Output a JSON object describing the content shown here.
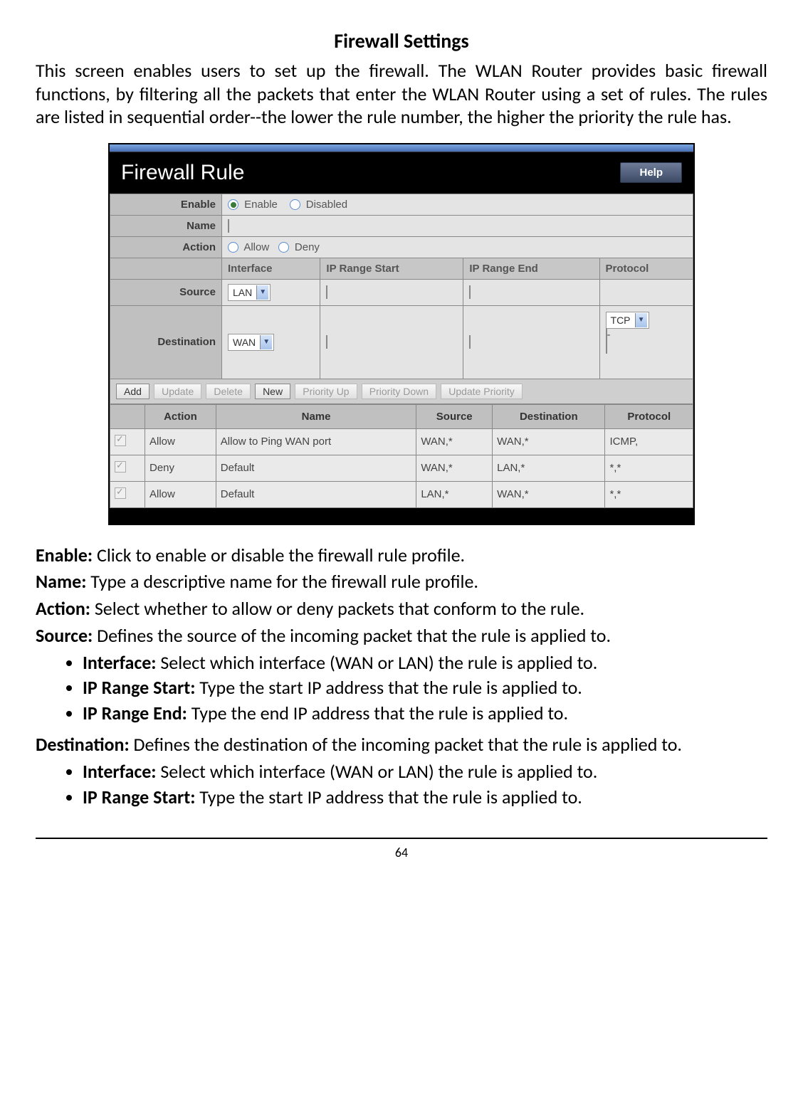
{
  "page": {
    "title": "Firewall Settings",
    "intro": "This screen enables users to set up the firewall. The WLAN Router provides basic firewall functions, by filtering all the packets that enter the WLAN Router using a set of rules. The rules are listed in sequential order--the lower the rule number, the higher the priority the rule has.",
    "page_number": "64"
  },
  "screenshot": {
    "panel_title": "Firewall Rule",
    "help_label": "Help",
    "labels": {
      "enable": "Enable",
      "name": "Name",
      "action": "Action",
      "source": "Source",
      "destination": "Destination"
    },
    "enable_options": {
      "enable": "Enable",
      "disabled": "Disabled"
    },
    "action_options": {
      "allow": "Allow",
      "deny": "Deny"
    },
    "columns": {
      "interface": "Interface",
      "ip_start": "IP Range Start",
      "ip_end": "IP Range End",
      "protocol": "Protocol"
    },
    "selects": {
      "source_if": "LAN",
      "dest_if": "WAN",
      "dest_proto": "TCP"
    },
    "buttons": {
      "add": "Add",
      "update": "Update",
      "delete": "Delete",
      "new": "New",
      "pri_up": "Priority Up",
      "pri_down": "Priority Down",
      "upd_pri": "Update Priority"
    },
    "rule_headers": {
      "action": "Action",
      "name": "Name",
      "source": "Source",
      "destination": "Destination",
      "protocol": "Protocol"
    },
    "rules": [
      {
        "action": "Allow",
        "name": "Allow to Ping WAN port",
        "source": "WAN,*",
        "dest": "WAN,*",
        "proto": "ICMP,"
      },
      {
        "action": "Deny",
        "name": "Default",
        "source": "WAN,*",
        "dest": "LAN,*",
        "proto": "*,*"
      },
      {
        "action": "Allow",
        "name": "Default",
        "source": "LAN,*",
        "dest": "WAN,*",
        "proto": "*,*"
      }
    ]
  },
  "defs": {
    "enable": {
      "term": "Enable:",
      "text": " Click to enable or disable the firewall rule profile."
    },
    "name": {
      "term": "Name:",
      "text": " Type a descriptive name for the firewall rule profile."
    },
    "action": {
      "term": "Action:",
      "text": " Select whether to allow or deny packets that conform to the rule."
    },
    "source": {
      "term": "Source:",
      "text": " Defines the source of the incoming packet that the rule is applied to."
    },
    "source_items": [
      {
        "term": "Interface:",
        "text": " Select which interface (WAN or LAN) the rule is applied to."
      },
      {
        "term": "IP Range Start:",
        "text": " Type the start IP address that the rule is applied to."
      },
      {
        "term": "IP Range End:",
        "text": " Type the end IP address that the rule is applied to."
      }
    ],
    "destination": {
      "term": "Destination:",
      "text": " Defines the destination of the incoming packet that the rule is applied to."
    },
    "dest_items": [
      {
        "term": "Interface:",
        "text": " Select which interface (WAN or LAN) the rule is applied to."
      },
      {
        "term": "IP Range Start:",
        "text": " Type the start IP address that the rule is applied to."
      }
    ]
  }
}
